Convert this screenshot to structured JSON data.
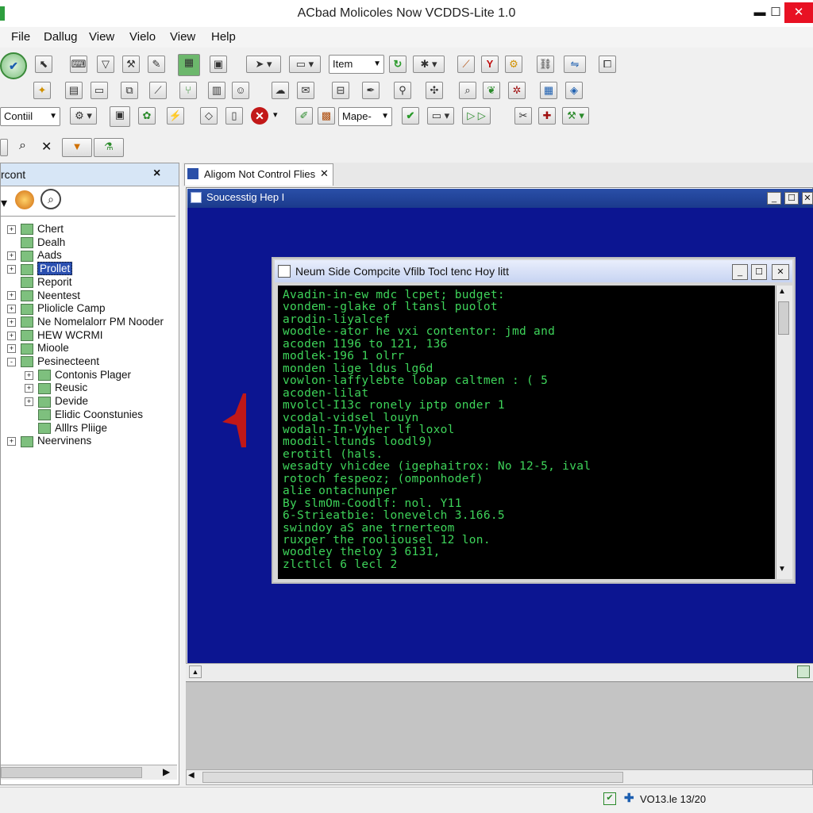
{
  "app": {
    "title": "ACbad Molicoles Now VCDDS-Lite 1.0"
  },
  "window_controls": {
    "minimize": "▬",
    "maximize": "☐",
    "close": "✕"
  },
  "menu": [
    "File",
    "Dallug",
    "View",
    "Vielo",
    "View",
    "Help"
  ],
  "toolbar": {
    "dropdown_control": "Contiil",
    "dropdown_mape": "Mape-",
    "dropdown_item": "Item"
  },
  "left_panel": {
    "header": "rcont",
    "close": "×",
    "tree": [
      {
        "label": "Chert",
        "expander": "+"
      },
      {
        "label": "Dealh",
        "expander": ""
      },
      {
        "label": "Aads",
        "expander": "+"
      },
      {
        "label": "Prollet",
        "expander": "+",
        "selected": true
      },
      {
        "label": "Reporit",
        "expander": ""
      },
      {
        "label": "Neentest",
        "expander": "+"
      },
      {
        "label": "Pliolicle Camp",
        "expander": "+"
      },
      {
        "label": "Ne Nomelalorr PM Nooder",
        "expander": "+"
      },
      {
        "label": "HEW WCRMI",
        "expander": "+"
      },
      {
        "label": "Mioole",
        "expander": "+"
      },
      {
        "label": "Pesinecteent",
        "expander": "-"
      },
      {
        "label": "Contonis Plager",
        "expander": "+",
        "indent": 1
      },
      {
        "label": "Reusic",
        "expander": "+",
        "indent": 1
      },
      {
        "label": "Devide",
        "expander": "+",
        "indent": 1
      },
      {
        "label": "Elidic Coonstunies",
        "expander": "",
        "indent": 1
      },
      {
        "label": "Alllrs Pliige",
        "expander": "",
        "indent": 1
      },
      {
        "label": "Neervinens",
        "expander": "+"
      }
    ]
  },
  "doc_tab": {
    "label": "Aligom Not Control Flies",
    "close": "✕"
  },
  "inner_window": {
    "title": "Soucesstig Hep I"
  },
  "console": {
    "title": "Neum Side Compcite Vfilb Tocl tenc Hoy litt",
    "lines": [
      "Avadin-in-ew mdc lcpet; budget:",
      "vondem--glake of ltansl puolot",
      "arodin-liyalcef",
      "woodle--ator he vxi contentor: jmd and",
      "acoden 1196 to 121, 136",
      "modlek-196 1 olrr",
      "monden lige ldus lg6d",
      "vowlon-laffylebte lobap caltmen : ( 5",
      "acoden-lilat",
      "mvolcl-I13c ronely iptp onder 1",
      "vcodal-vidsel louyn",
      "wodaln-In-Vyher lf loxol",
      "moodil-ltunds loodl9)",
      "erotitl (hals.",
      "wesadty vhicdee (igephaitrox: No 12-5, ival",
      "rotoch fespeoz; (omponhodef)",
      "alie ontachunper",
      "By slmOm-Coodlf: nol. Y11",
      "6-Strieatbie: lonevelch 3.166.5",
      "swindoy aS ane trnerteom",
      "ruxper the rooliousel 12 lon.",
      "woodley theloy 3 6131,",
      "zlctlcl 6 lecl 2"
    ]
  },
  "status": {
    "text": "VO13.le 13/20"
  },
  "colors": {
    "console_text": "#3ed45a",
    "inner_background": "#0c1591",
    "title_gradient_top": "#2a4fa8",
    "close_red": "#e81123"
  }
}
